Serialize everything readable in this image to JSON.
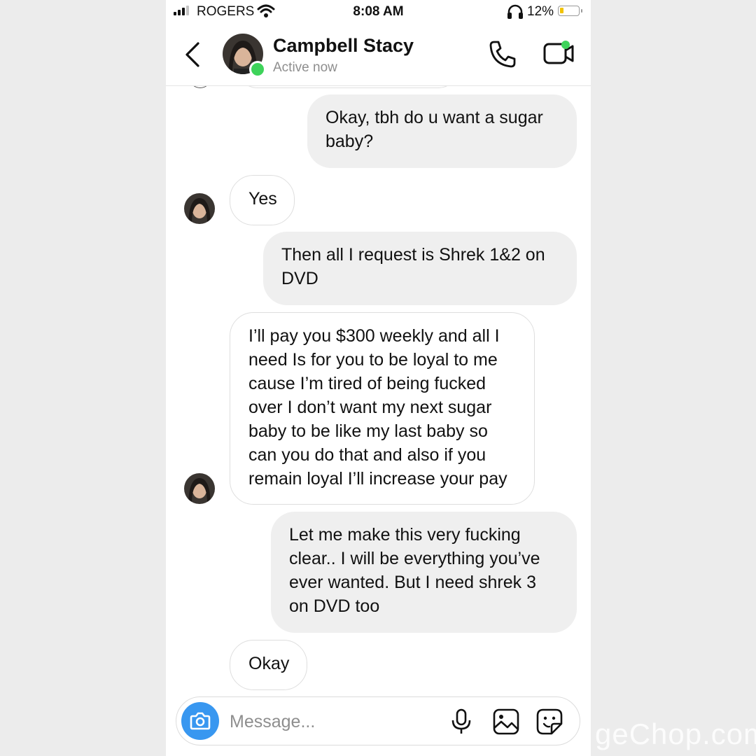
{
  "status_bar": {
    "carrier": "ROGERS",
    "time": "8:08 AM",
    "battery": "12%",
    "battery_level": 0.12,
    "signal_bars": 3
  },
  "header": {
    "contact_name": "Campbell Stacy",
    "status": "Active now",
    "icons": [
      "back-chevron-icon",
      "phone-call-icon",
      "video-call-icon"
    ]
  },
  "messages": [
    {
      "sender": "me",
      "text": "Okay, tbh do u want a sugar baby?"
    },
    {
      "sender": "contact",
      "text": "Yes"
    },
    {
      "sender": "me",
      "text": "Then all I request is Shrek 1&2 on DVD"
    },
    {
      "sender": "contact",
      "text": "I’ll pay you $300 weekly and all I need Is for you to be loyal to me cause I’m tired of being fucked over I don’t want my next sugar baby to be like my last baby so can you do that and also if you remain loyal I’ll increase your pay"
    },
    {
      "sender": "me",
      "text": "Let me make this very fucking clear.. I will be everything you’ve ever wanted. But I need shrek 3 on DVD too"
    },
    {
      "sender": "contact",
      "text": "Okay"
    }
  ],
  "composer": {
    "placeholder": "Message...",
    "icons": [
      "camera-icon",
      "microphone-icon",
      "gallery-icon",
      "sticker-icon"
    ]
  },
  "colors": {
    "accent": "#3897f0",
    "online": "#3ed35a",
    "outgoing_bubble": "#efefef"
  },
  "watermark": "geChop.com"
}
